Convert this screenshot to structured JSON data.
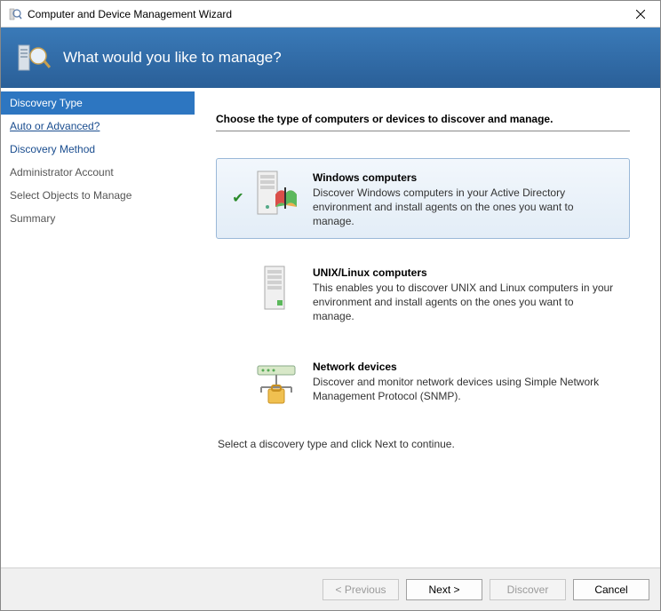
{
  "window": {
    "title": "Computer and Device Management Wizard"
  },
  "header": {
    "title": "What would you like to manage?"
  },
  "sidebar": {
    "items": [
      {
        "label": "Discovery Type",
        "state": "active"
      },
      {
        "label": "Auto or Advanced?",
        "state": "link"
      },
      {
        "label": "Discovery Method",
        "state": "link2"
      },
      {
        "label": "Administrator Account",
        "state": "normal"
      },
      {
        "label": "Select Objects to Manage",
        "state": "normal"
      },
      {
        "label": "Summary",
        "state": "normal"
      }
    ]
  },
  "main": {
    "instruction": "Choose the type of computers or devices to discover and manage.",
    "options": [
      {
        "title": "Windows computers",
        "desc": "Discover Windows computers in your Active Directory environment and install agents on the ones you want to manage.",
        "selected": true,
        "icon": "windows"
      },
      {
        "title": "UNIX/Linux computers",
        "desc": "This enables you to discover UNIX and Linux computers in your environment and install agents on the ones you want to manage.",
        "selected": false,
        "icon": "unix"
      },
      {
        "title": "Network devices",
        "desc": "Discover and monitor network devices using Simple Network Management Protocol (SNMP).",
        "selected": false,
        "icon": "network"
      }
    ],
    "hint": "Select a discovery type and click Next to continue."
  },
  "footer": {
    "previous": "< Previous",
    "next": "Next >",
    "discover": "Discover",
    "cancel": "Cancel"
  }
}
